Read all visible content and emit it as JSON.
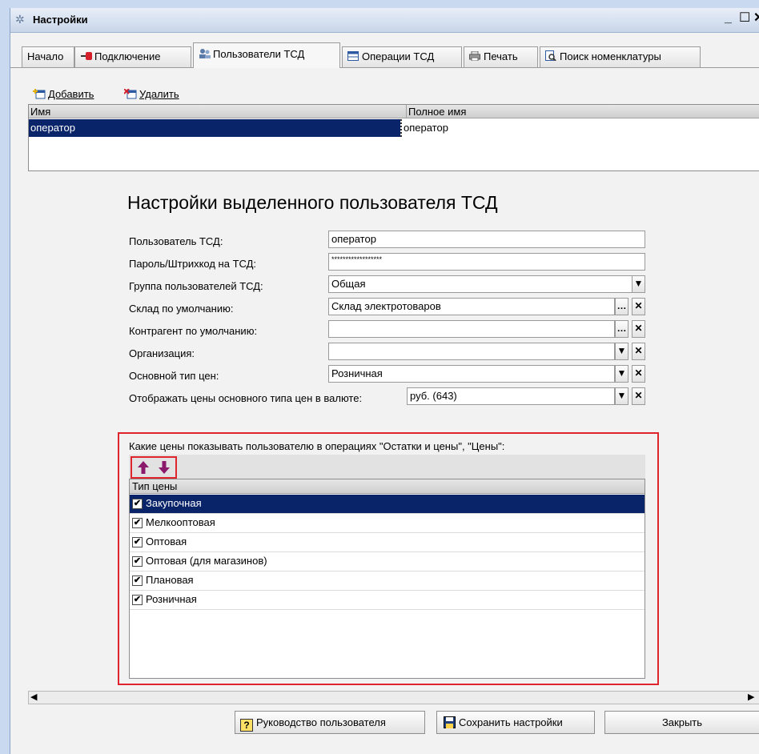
{
  "window": {
    "title": "Настройки"
  },
  "tabs": [
    {
      "label": "Начало"
    },
    {
      "label": "Подключение"
    },
    {
      "label": "Пользователи ТСД"
    },
    {
      "label": "Операции ТСД"
    },
    {
      "label": "Печать"
    },
    {
      "label": "Поиск номенклатуры"
    }
  ],
  "toolbar": {
    "add_label": "Добавить",
    "delete_label": "Удалить"
  },
  "users_table": {
    "columns": [
      "Имя",
      "Полное имя"
    ],
    "rows": [
      {
        "name": "оператор",
        "full_name": "оператор"
      }
    ]
  },
  "form": {
    "title": "Настройки выделенного пользователя ТСД",
    "fields": [
      {
        "label": "Пользователь ТСД:",
        "value": "оператор"
      },
      {
        "label": "Пароль/Штрихкод на ТСД:",
        "value": "******************"
      },
      {
        "label": "Группа пользователей ТСД:",
        "value": "Общая"
      },
      {
        "label": "Склад по умолчанию:",
        "value": "Склад электротоваров"
      },
      {
        "label": "Контрагент по умолчанию:",
        "value": ""
      },
      {
        "label": "Организация:",
        "value": ""
      },
      {
        "label": "Основной тип цен:",
        "value": "Розничная"
      },
      {
        "label": "Отображать цены основного типа цен в валюте:",
        "value": "руб. (643)"
      }
    ]
  },
  "prices": {
    "caption": "Какие цены показывать пользователю в операциях \"Остатки и цены\", \"Цены\":",
    "column": "Тип цены",
    "rows": [
      {
        "label": "Закупочная",
        "checked": true
      },
      {
        "label": "Мелкооптовая",
        "checked": true
      },
      {
        "label": "Оптовая",
        "checked": true
      },
      {
        "label": "Оптовая (для магазинов)",
        "checked": true
      },
      {
        "label": "Плановая",
        "checked": true
      },
      {
        "label": "Розничная",
        "checked": true
      }
    ]
  },
  "buttons": {
    "help_icon": "?",
    "help_label": "Руководство пользователя",
    "save_label": "Сохранить настройки",
    "close_label": "Закрыть"
  },
  "colors": {
    "selection": "#0a246a",
    "highlight_frame": "#e0242e",
    "arrows": "#8b1a6b"
  }
}
